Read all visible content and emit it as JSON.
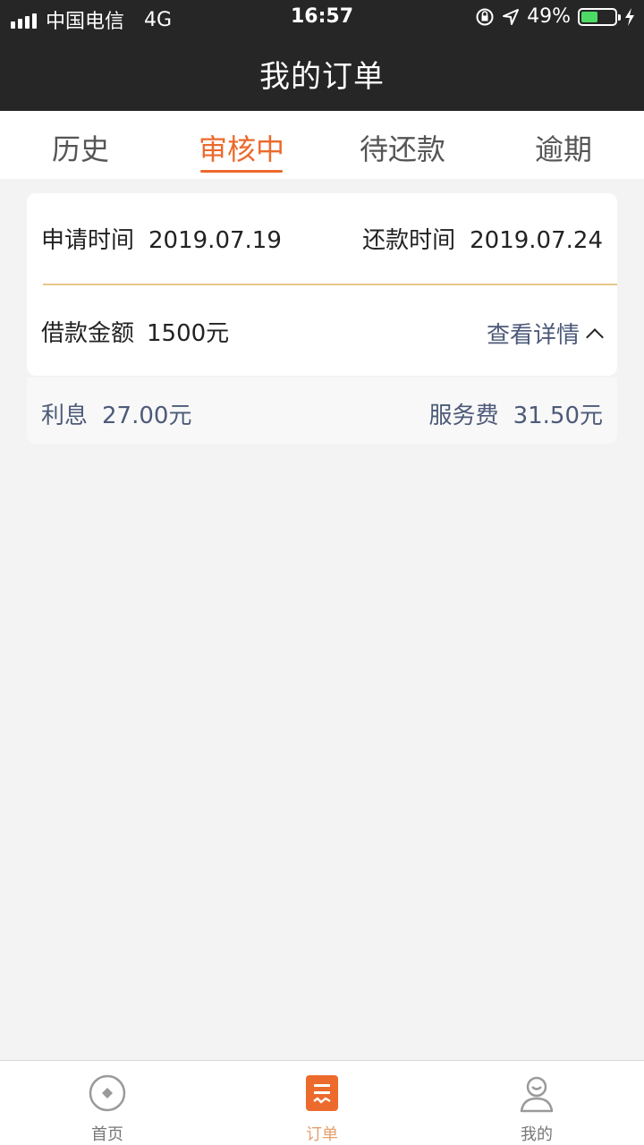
{
  "status_bar": {
    "carrier": "中国电信",
    "network": "4G",
    "time": "16:57",
    "battery": "49%",
    "battery_level": 0.49,
    "battery_color": "#4cd964"
  },
  "header": {
    "title": "我的订单"
  },
  "tabs": [
    {
      "label": "历史",
      "active": false
    },
    {
      "label": "审核中",
      "active": true
    },
    {
      "label": "待还款",
      "active": false
    },
    {
      "label": "逾期",
      "active": false
    }
  ],
  "order": {
    "apply_label": "申请时间",
    "apply_date": "2019.07.19",
    "repay_label": "还款时间",
    "repay_date": "2019.07.24",
    "amount_label": "借款金额",
    "amount_value": "1500元",
    "detail_label": "查看详情"
  },
  "fees": {
    "interest_label": "利息",
    "interest_value": "27.00元",
    "service_label": "服务费",
    "service_value": "31.50元"
  },
  "tabbar": [
    {
      "label": "首页",
      "icon": "home-coin-icon",
      "active": false
    },
    {
      "label": "订单",
      "icon": "order-list-icon",
      "active": true
    },
    {
      "label": "我的",
      "icon": "profile-icon",
      "active": false
    }
  ],
  "colors": {
    "accent": "#ec6a2c",
    "header_bg": "#262626",
    "divider": "#e6c789",
    "link": "#4d5a79"
  }
}
